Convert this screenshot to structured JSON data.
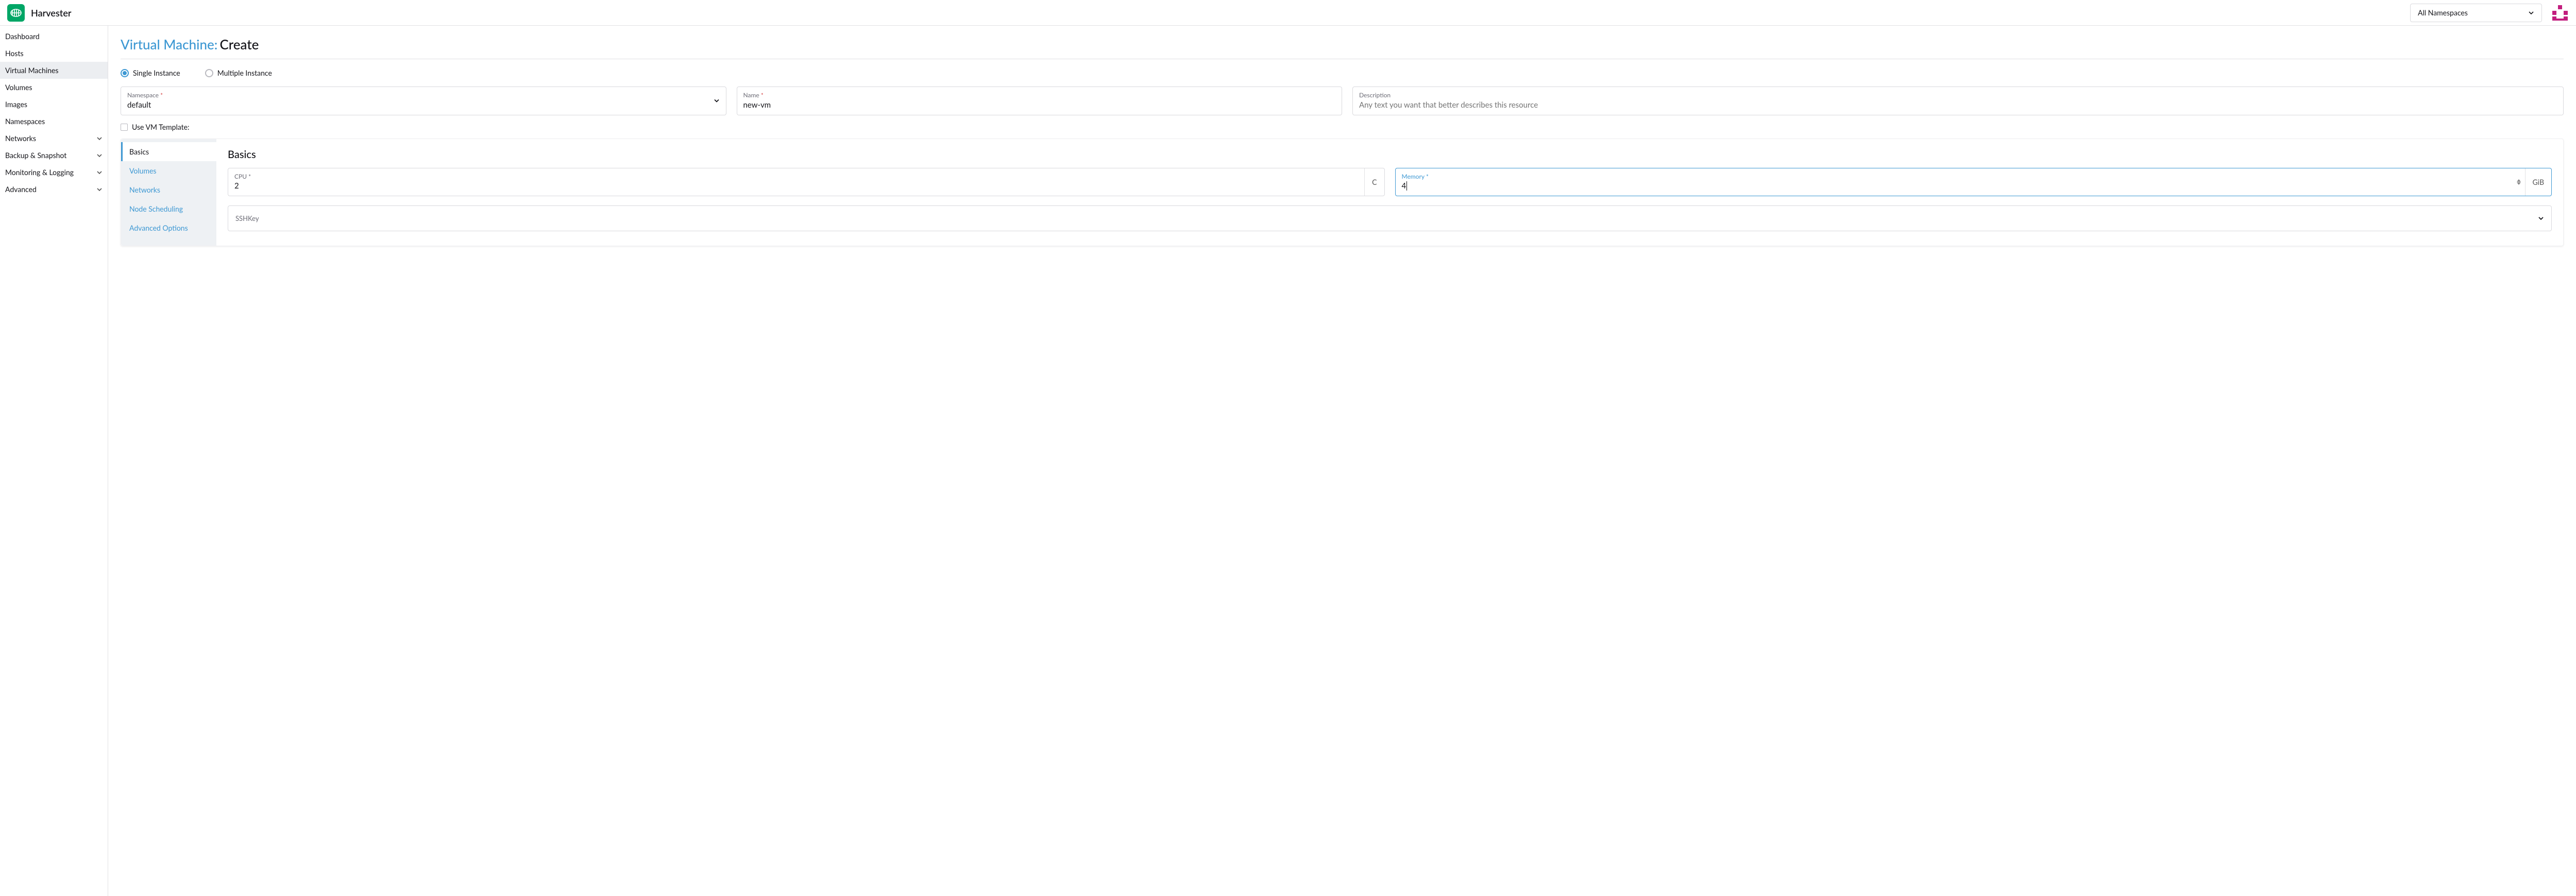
{
  "header": {
    "brand": "Harvester",
    "namespace_selector": "All Namespaces"
  },
  "sidebar": {
    "items": [
      {
        "label": "Dashboard",
        "expandable": false
      },
      {
        "label": "Hosts",
        "expandable": false
      },
      {
        "label": "Virtual Machines",
        "expandable": false,
        "active": true
      },
      {
        "label": "Volumes",
        "expandable": false
      },
      {
        "label": "Images",
        "expandable": false
      },
      {
        "label": "Namespaces",
        "expandable": false
      },
      {
        "label": "Networks",
        "expandable": true
      },
      {
        "label": "Backup & Snapshot",
        "expandable": true
      },
      {
        "label": "Monitoring & Logging",
        "expandable": true
      },
      {
        "label": "Advanced",
        "expandable": true
      }
    ]
  },
  "page": {
    "title_prefix": "Virtual Machine:",
    "title_action": "Create",
    "instance_options": {
      "single": "Single Instance",
      "multiple": "Multiple Instance",
      "selected": "single"
    },
    "fields": {
      "namespace": {
        "label": "Namespace",
        "value": "default"
      },
      "name": {
        "label": "Name",
        "value": "new-vm"
      },
      "description": {
        "label": "Description",
        "placeholder": "Any text you want that better describes this resource",
        "value": ""
      }
    },
    "use_template_label": "Use VM Template:",
    "tabs": [
      {
        "label": "Basics",
        "active": true
      },
      {
        "label": "Volumes"
      },
      {
        "label": "Networks"
      },
      {
        "label": "Node Scheduling"
      },
      {
        "label": "Advanced Options"
      }
    ],
    "basics": {
      "heading": "Basics",
      "cpu": {
        "label": "CPU",
        "value": "2",
        "unit": "C"
      },
      "memory": {
        "label": "Memory",
        "value": "4",
        "unit": "GiB"
      },
      "sshkey": {
        "label": "SSHKey"
      }
    }
  }
}
